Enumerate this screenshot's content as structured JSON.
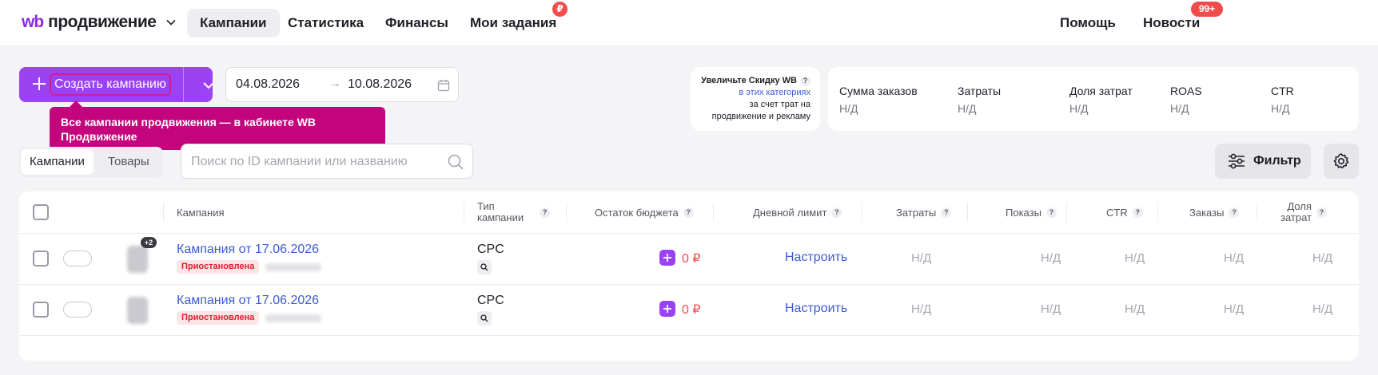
{
  "header": {
    "logo_wb": "wb",
    "logo_text": "продвижение",
    "nav": [
      {
        "label": "Кампании",
        "active": true
      },
      {
        "label": "Статистика",
        "active": false
      },
      {
        "label": "Финансы",
        "active": false
      },
      {
        "label": "Мои задания",
        "active": false
      }
    ],
    "tasks_badge": "₽",
    "help_label": "Помощь",
    "news_label": "Новости",
    "news_badge": "99+"
  },
  "toolbar": {
    "create_label": "Создать кампанию",
    "date_from": "04.08.2026",
    "date_arrow": "→",
    "date_to": "10.08.2026",
    "tooltip": "Все кампании продвижения — в кабинете WB Продвижение"
  },
  "promo": {
    "title": "Увеличьте Скидку WB",
    "help": "?",
    "link": "в этих категориях",
    "line1": "за счет трат на",
    "line2": "продвижение и рекламу"
  },
  "stats": [
    {
      "label": "Сумма заказов",
      "value": "Н/Д"
    },
    {
      "label": "Затраты",
      "value": "Н/Д"
    },
    {
      "label": "Доля затрат",
      "value": "Н/Д"
    },
    {
      "label": "ROAS",
      "value": "Н/Д"
    },
    {
      "label": "CTR",
      "value": "Н/Д"
    }
  ],
  "tabs": [
    {
      "label": "Кампании",
      "active": true
    },
    {
      "label": "Товары",
      "active": false
    }
  ],
  "search": {
    "placeholder": "Поиск по ID кампании или названию"
  },
  "filter_label": "Фильтр",
  "table": {
    "columns": {
      "campaign": "Кампания",
      "type_1": "Тип",
      "type_2": "кампании",
      "budget": "Остаток бюджета",
      "daily": "Дневной лимит",
      "spend": "Затраты",
      "shows": "Показы",
      "ctr": "CTR",
      "orders": "Заказы",
      "share_1": "Доля",
      "share_2": "затрат",
      "help": "?"
    },
    "rows": [
      {
        "plus_count": "+2",
        "name": "Кампания от 17.06.2026",
        "status": "Приостановлена",
        "type": "CPC",
        "budget": "0 ₽",
        "daily": "Настроить",
        "spend": "Н/Д",
        "shows": "Н/Д",
        "ctr": "Н/Д",
        "orders": "Н/Д",
        "share": "Н/Д"
      },
      {
        "plus_count": "",
        "name": "Кампания от 17.06.2026",
        "status": "Приостановлена",
        "type": "CPC",
        "budget": "0 ₽",
        "daily": "Настроить",
        "spend": "Н/Д",
        "shows": "Н/Д",
        "ctr": "Н/Д",
        "orders": "Н/Д",
        "share": "Н/Д"
      }
    ]
  },
  "colors": {
    "accent": "#9b42f5",
    "tooltip": "#c4047d",
    "link": "#3c5ad6",
    "danger": "#f24b4b"
  }
}
